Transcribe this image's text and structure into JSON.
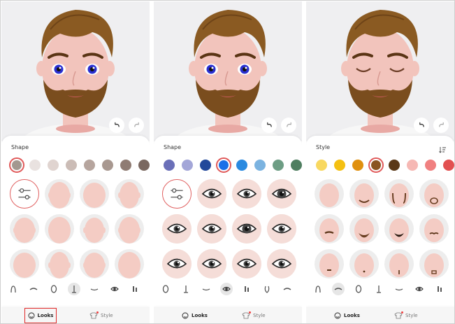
{
  "panels": [
    {
      "sheet_title": "Shape",
      "eyes": "open-blue",
      "swatches": [
        "#a39890",
        "#e9e2e0",
        "#e0d4d0",
        "#cbbcb6",
        "#b6a59e",
        "#a89890",
        "#8f7c73",
        "#7a6860"
      ],
      "selected_swatch": 0,
      "grid_kind": "face",
      "selected_category": 3,
      "show_sort": false,
      "looks_boxed": true
    },
    {
      "sheet_title": "Shape",
      "eyes": "open-blue",
      "swatches": [
        "#6a6fb8",
        "#a3a6d8",
        "#22489a",
        "#1a70e8",
        "#2a8ae0",
        "#7bb3e0",
        "#6d9d84",
        "#4f7e60"
      ],
      "selected_swatch": 3,
      "grid_kind": "eye",
      "selected_category": 3,
      "show_sort": false,
      "looks_boxed": false
    },
    {
      "sheet_title": "Style",
      "eyes": "closed",
      "swatches": [
        "#f8d860",
        "#f4c012",
        "#e0900e",
        "#8a5520",
        "#5a3818",
        "#f6b8b4",
        "#f08080",
        "#e25050"
      ],
      "selected_swatch": 3,
      "grid_kind": "beard",
      "selected_category": 1,
      "show_sort": true,
      "looks_boxed": false
    }
  ],
  "nav": {
    "looks_label": "Looks",
    "style_label": "Style"
  },
  "colors": {
    "accent_red": "#e05a5a",
    "skin": "#f2c4bc",
    "hair": "#8a5a22",
    "beard": "#7a4d1e"
  }
}
